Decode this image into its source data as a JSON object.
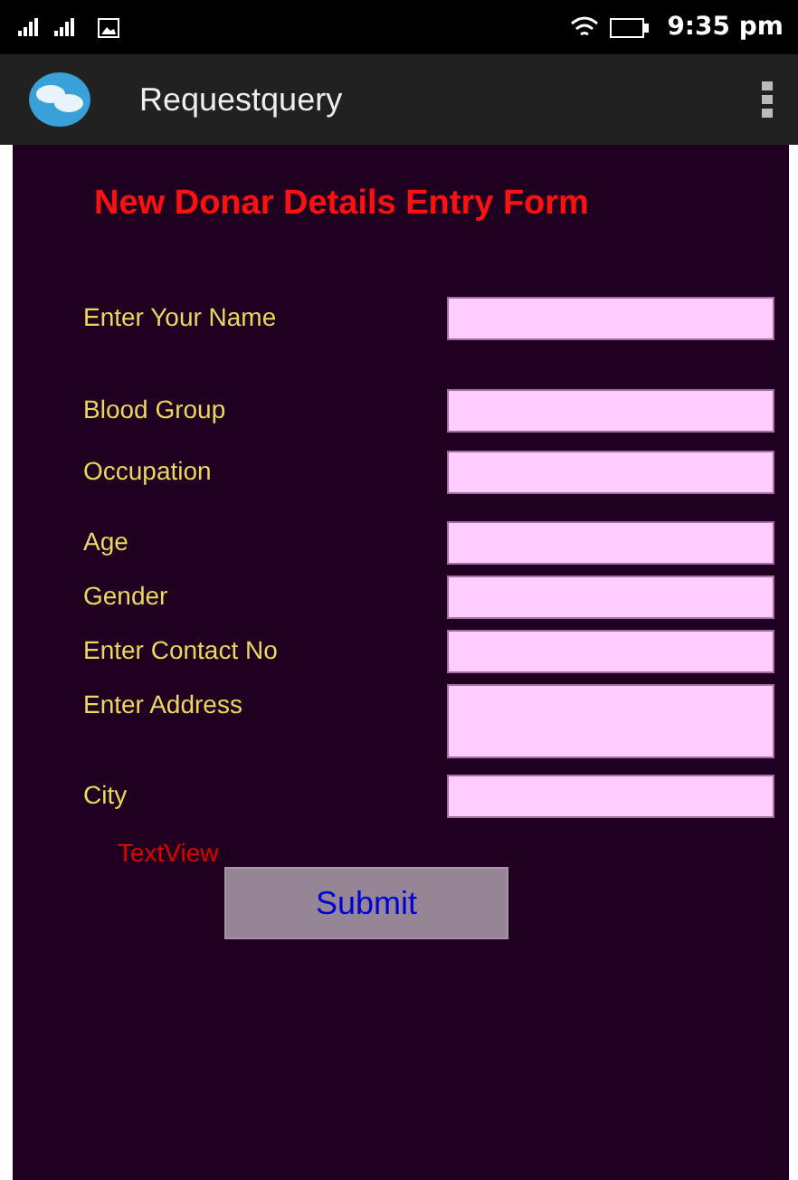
{
  "status_bar": {
    "time": "9:35 pm"
  },
  "app_bar": {
    "title": "Requestquery"
  },
  "form": {
    "heading": "New Donar Details Entry Form",
    "rows": [
      {
        "label": "Enter Your Name",
        "kind": "single"
      },
      {
        "label": "Blood Group",
        "kind": "single"
      },
      {
        "label": "Occupation",
        "kind": "single"
      },
      {
        "label": "Age",
        "kind": "single"
      },
      {
        "label": "Gender",
        "kind": "single"
      },
      {
        "label": "Enter Contact No",
        "kind": "single"
      },
      {
        "label": "Enter Address",
        "kind": "multiline"
      },
      {
        "label": "City",
        "kind": "single"
      }
    ],
    "message": "TextView",
    "submit": "Submit"
  }
}
